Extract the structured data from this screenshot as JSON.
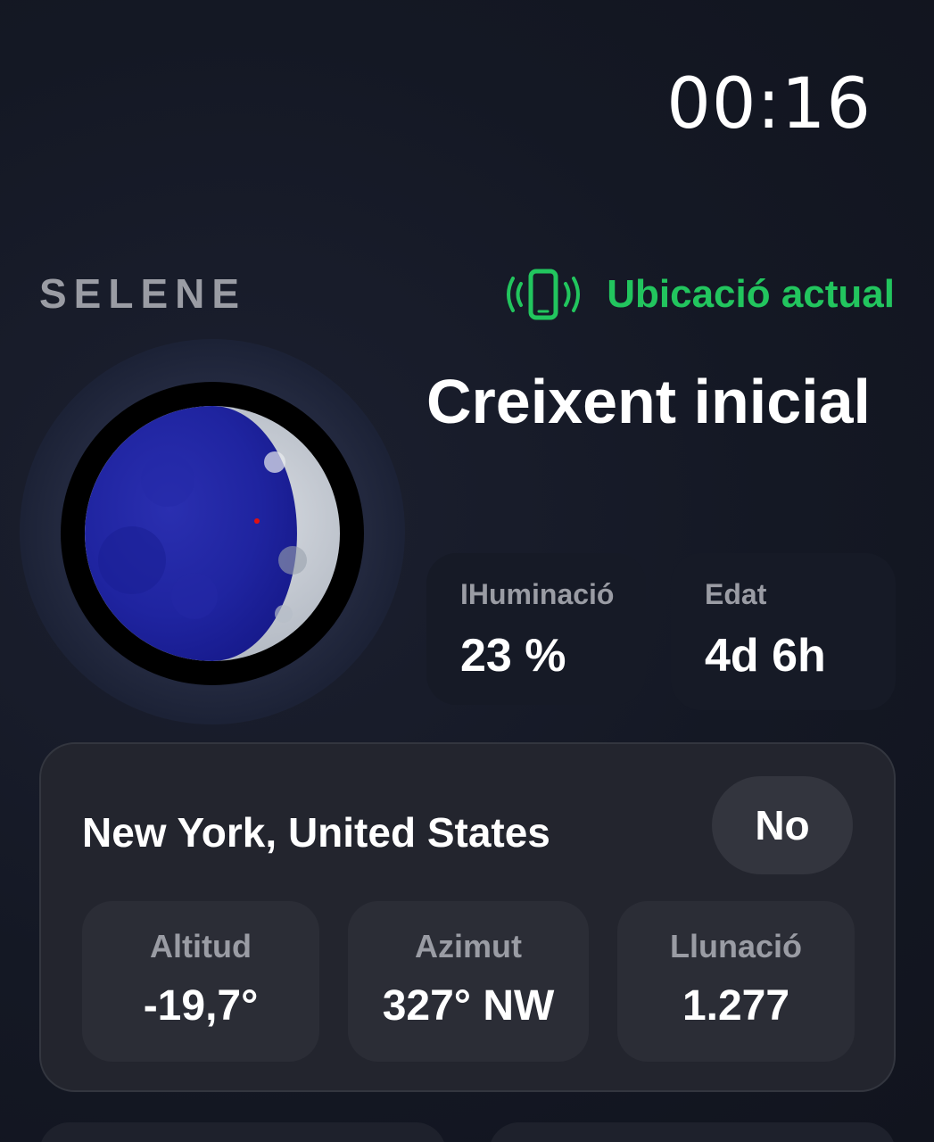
{
  "status": {
    "time": "00:16"
  },
  "header": {
    "app_name": "SELENE",
    "location_label": "Ubicació actual",
    "location_icon": "phone-location-icon",
    "accent_color": "#22c55e"
  },
  "moon": {
    "image": "moon-phase-icon",
    "phase_name": "Creixent inicial",
    "illumination": {
      "label": "IHuminació",
      "value": "23 %"
    },
    "age": {
      "label": "Edat",
      "value": "4d 6h"
    }
  },
  "location_card": {
    "city": "New York, United States",
    "toggle_label": "No",
    "stats": [
      {
        "label": "Altitud",
        "value": "-19,7°"
      },
      {
        "label": "Azimut",
        "value": "327° NW"
      },
      {
        "label": "Llunació",
        "value": "1.277"
      }
    ]
  }
}
